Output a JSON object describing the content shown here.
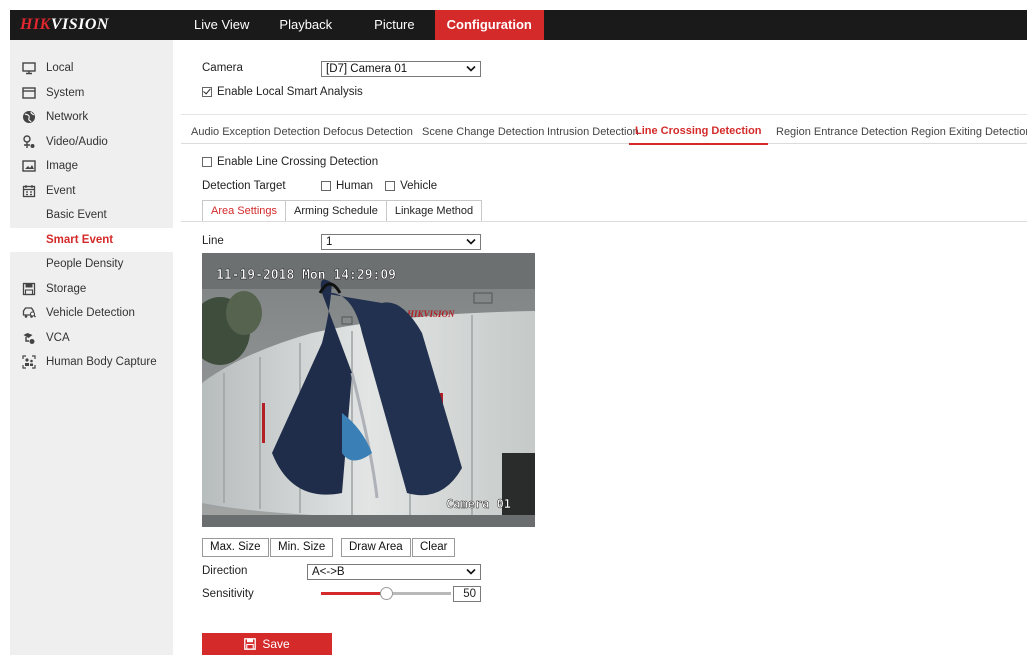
{
  "brand": {
    "prefix": "HIK",
    "suffix": "VISION"
  },
  "nav": {
    "items": [
      {
        "label": "Live View",
        "active": false
      },
      {
        "label": "Playback",
        "active": false
      },
      {
        "label": "Picture",
        "active": false
      },
      {
        "label": "Configuration",
        "active": true
      }
    ]
  },
  "sidebar": {
    "items": [
      {
        "label": "Local",
        "icon": "monitor-icon",
        "sub": false
      },
      {
        "label": "System",
        "icon": "system-window-icon",
        "sub": false
      },
      {
        "label": "Network",
        "icon": "globe-icon",
        "sub": false
      },
      {
        "label": "Video/Audio",
        "icon": "video-audio-icon",
        "sub": false
      },
      {
        "label": "Image",
        "icon": "image-icon",
        "sub": false
      },
      {
        "label": "Event",
        "icon": "calendar-icon",
        "sub": false
      },
      {
        "label": "Basic Event",
        "icon": "",
        "sub": true
      },
      {
        "label": "Smart Event",
        "icon": "",
        "sub": true,
        "active": true
      },
      {
        "label": "People Density",
        "icon": "",
        "sub": true
      },
      {
        "label": "Storage",
        "icon": "storage-icon",
        "sub": false
      },
      {
        "label": "Vehicle Detection",
        "icon": "vehicle-detection-icon",
        "sub": false
      },
      {
        "label": "VCA",
        "icon": "vca-icon",
        "sub": false
      },
      {
        "label": "Human Body Capture",
        "icon": "human-body-capture-icon",
        "sub": false
      }
    ]
  },
  "camera": {
    "label": "Camera",
    "value": "[D7] Camera 01"
  },
  "local_smart": {
    "label": "Enable Local Smart Analysis",
    "checked": true
  },
  "tabs": [
    {
      "label": "Audio Exception Detection",
      "active": false
    },
    {
      "label": "Defocus Detection",
      "active": false
    },
    {
      "label": "Scene Change Detection",
      "active": false
    },
    {
      "label": "Intrusion Detection",
      "active": false
    },
    {
      "label": "Line Crossing Detection",
      "active": true
    },
    {
      "label": "Region Entrance Detection",
      "active": false
    },
    {
      "label": "Region Exiting Detection",
      "active": false
    }
  ],
  "enable_line": {
    "label": "Enable Line Crossing Detection",
    "checked": false
  },
  "target": {
    "label": "Detection Target",
    "human": {
      "label": "Human",
      "checked": false
    },
    "vehicle": {
      "label": "Vehicle",
      "checked": false
    }
  },
  "subtabs": [
    {
      "label": "Area Settings",
      "active": true
    },
    {
      "label": "Arming Schedule",
      "active": false
    },
    {
      "label": "Linkage Method",
      "active": false
    }
  ],
  "line": {
    "label": "Line",
    "value": "1"
  },
  "video": {
    "timestamp": "11-19-2018 Mon 14:29:09",
    "camera_name": "Camera 01",
    "cabinet_brand": "HIKVISION"
  },
  "buttons": {
    "max_size": "Max. Size",
    "min_size": "Min. Size",
    "draw_area": "Draw Area",
    "clear": "Clear"
  },
  "direction": {
    "label": "Direction",
    "value": "A<->B"
  },
  "sensitivity": {
    "label": "Sensitivity",
    "value": "50",
    "fraction": 0.5
  },
  "save": {
    "label": "Save"
  },
  "colors": {
    "accent": "#d42a2a",
    "topbar": "#1a1a1a",
    "sidebar": "#efefef"
  }
}
